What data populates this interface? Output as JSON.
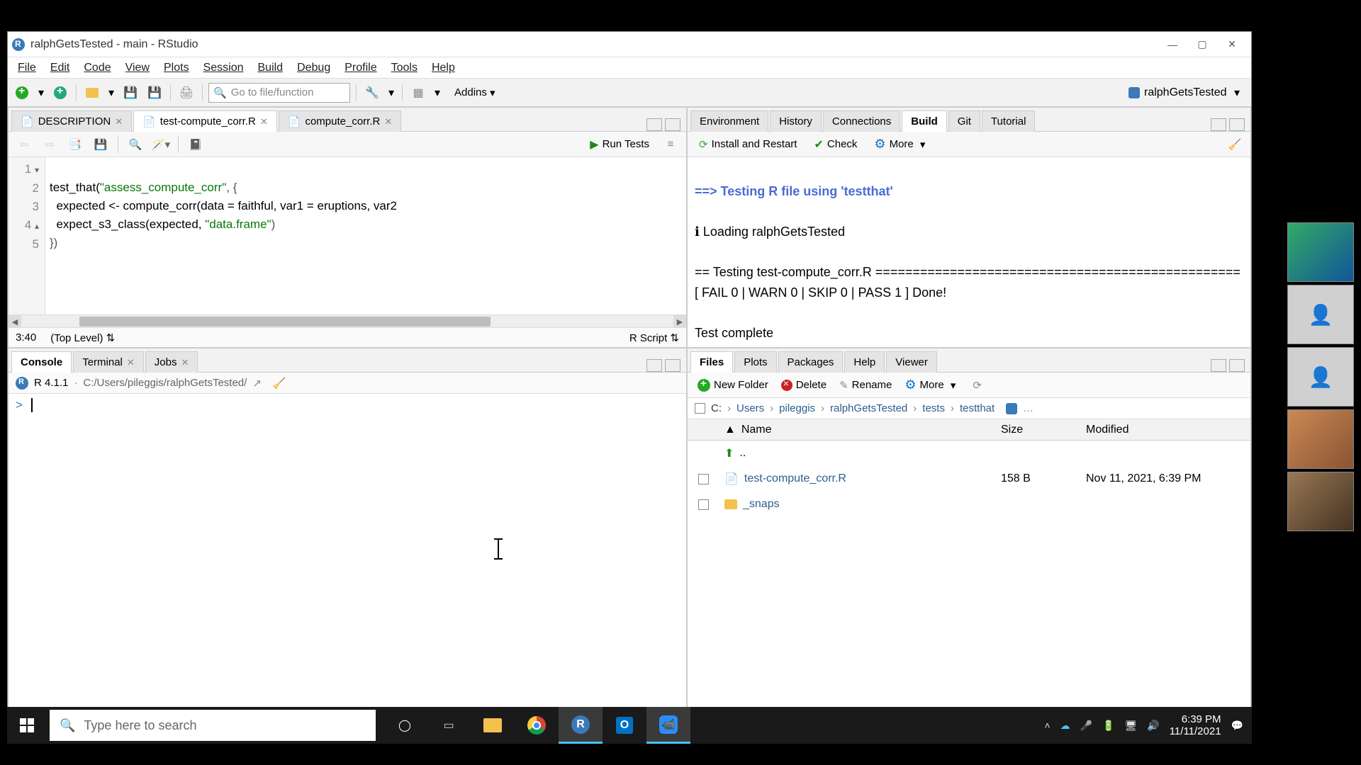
{
  "window": {
    "title": "ralphGetsTested - main - RStudio"
  },
  "menus": [
    "File",
    "Edit",
    "Code",
    "View",
    "Plots",
    "Session",
    "Build",
    "Debug",
    "Profile",
    "Tools",
    "Help"
  ],
  "toolbar": {
    "goto_placeholder": "Go to file/function",
    "addins": "Addins",
    "project": "ralphGetsTested"
  },
  "source": {
    "tabs": [
      {
        "name": "DESCRIPTION",
        "closable": true
      },
      {
        "name": "test-compute_corr.R",
        "closable": true,
        "active": true
      },
      {
        "name": "compute_corr.R",
        "closable": true
      }
    ],
    "run_btn": "Run Tests",
    "line_numbers": [
      "1",
      "2",
      "3",
      "4",
      "5"
    ],
    "code_lines": {
      "l1_pre": "test_that(",
      "l1_str": "\"assess_compute_corr\"",
      "l1_post": ", {",
      "l2": "  expected <- compute_corr(data = faithful, var1 = eruptions, var2",
      "l3_pre": "  expect_s3_class(expected, ",
      "l3_str": "\"data.frame\"",
      "l3_post": ")",
      "l4": "})"
    },
    "status_pos": "3:40",
    "status_scope": "(Top Level)",
    "status_type": "R Script"
  },
  "console": {
    "tabs": [
      "Console",
      "Terminal",
      "Jobs"
    ],
    "version": "R 4.1.1",
    "path": "C:/Users/pileggis/ralphGetsTested/",
    "prompt": ">"
  },
  "build": {
    "tabs": [
      "Environment",
      "History",
      "Connections",
      "Build",
      "Git",
      "Tutorial"
    ],
    "install": "Install and Restart",
    "check": "Check",
    "more": "More",
    "out_header": "==> Testing R file using 'testthat'",
    "out_load": "ℹ Loading ralphGetsTested",
    "out_sep": "== Testing test-compute_corr.R =================================================",
    "out_result": "[ FAIL 0 | WARN 0 | SKIP 0 | PASS 1 ] Done!",
    "out_complete": "Test complete"
  },
  "files": {
    "tabs": [
      "Files",
      "Plots",
      "Packages",
      "Help",
      "Viewer"
    ],
    "new_folder": "New Folder",
    "delete": "Delete",
    "rename": "Rename",
    "more": "More",
    "breadcrumb": [
      "C:",
      "Users",
      "pileggis",
      "ralphGetsTested",
      "tests",
      "testthat"
    ],
    "cols": {
      "name": "Name",
      "size": "Size",
      "modified": "Modified"
    },
    "up": "..",
    "rows": [
      {
        "name": "test-compute_corr.R",
        "size": "158 B",
        "modified": "Nov 11, 2021, 6:39 PM",
        "type": "r"
      },
      {
        "name": "_snaps",
        "size": "",
        "modified": "",
        "type": "folder"
      }
    ]
  },
  "taskbar": {
    "search_placeholder": "Type here to search",
    "time": "6:39 PM",
    "date": "11/11/2021"
  }
}
